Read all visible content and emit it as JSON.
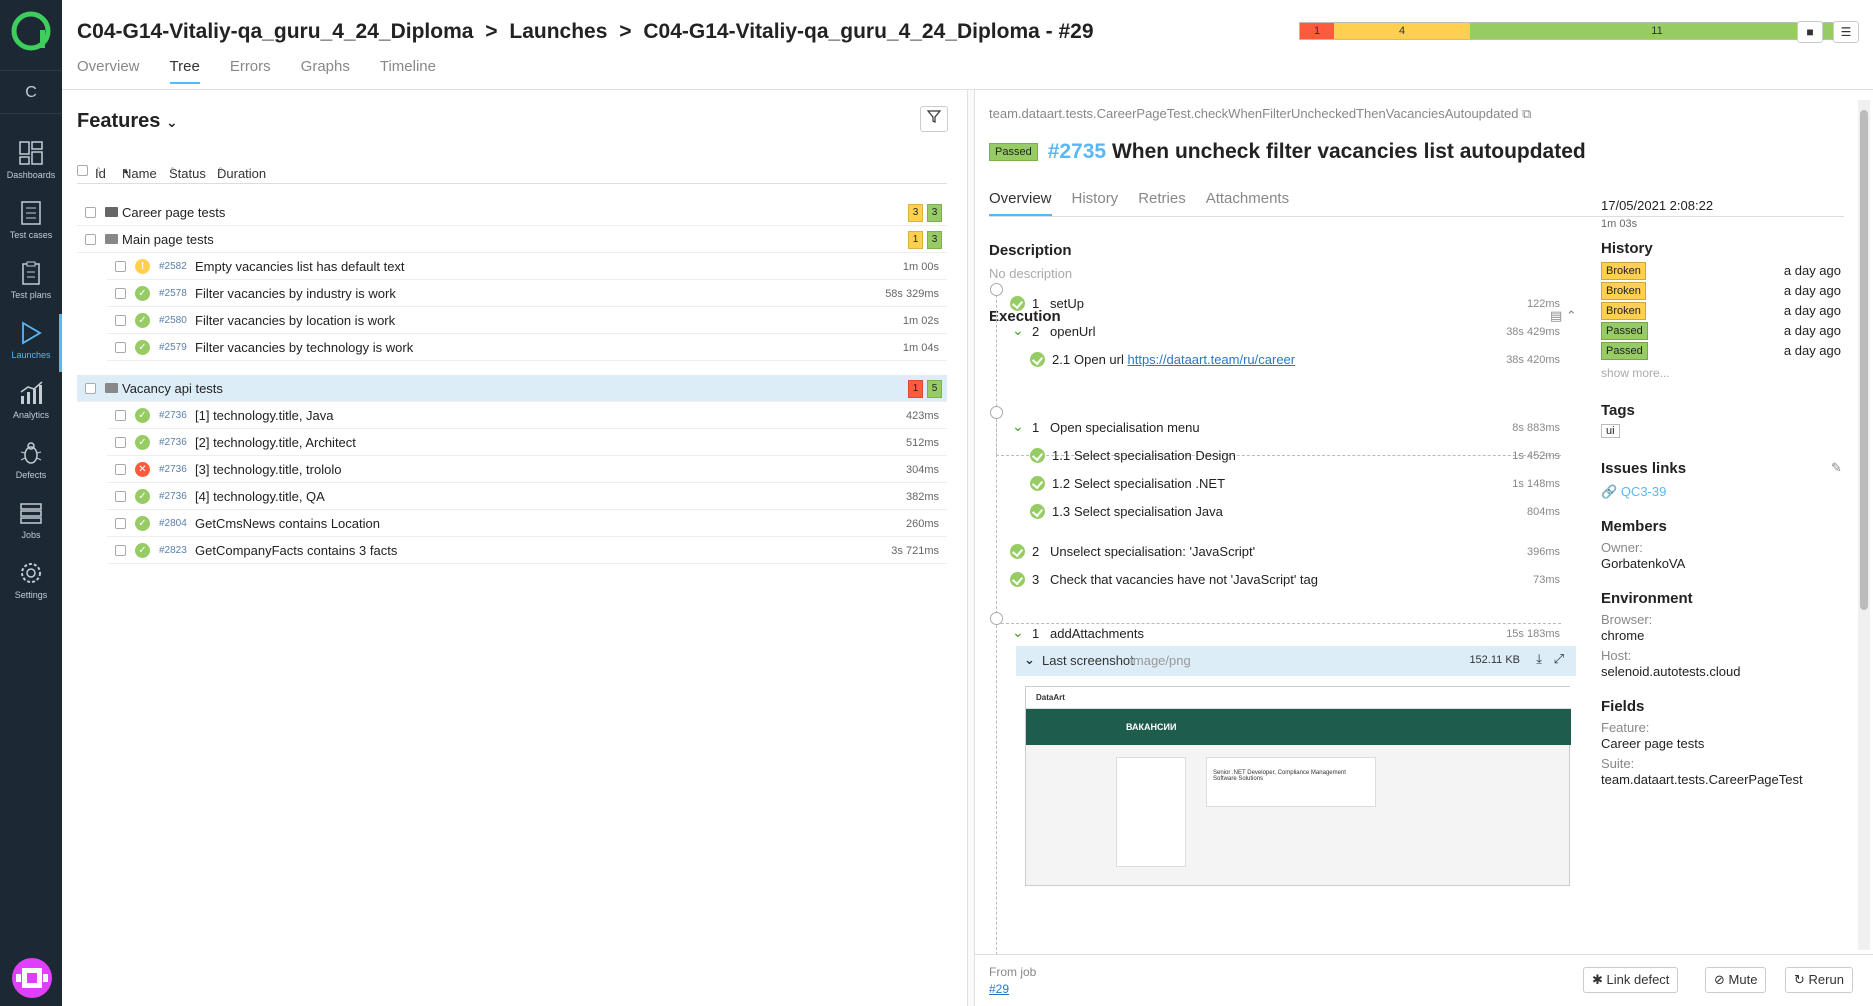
{
  "sidebar": {
    "collapse_label": "C",
    "items": [
      {
        "label": "Dashboards",
        "icon": "dashboards-icon"
      },
      {
        "label": "Test cases",
        "icon": "test-cases-icon"
      },
      {
        "label": "Test plans",
        "icon": "test-plans-icon"
      },
      {
        "label": "Launches",
        "icon": "launches-icon"
      },
      {
        "label": "Analytics",
        "icon": "analytics-icon"
      },
      {
        "label": "Defects",
        "icon": "defects-icon"
      },
      {
        "label": "Jobs",
        "icon": "jobs-icon"
      },
      {
        "label": "Settings",
        "icon": "settings-icon"
      }
    ],
    "accent": "#5ab7f6",
    "background": "#1c2834"
  },
  "header": {
    "crumb1": "C04-G14-Vitaliy-qa_guru_4_24_Diploma",
    "crumb2": "Launches",
    "crumb3": "C04-G14-Vitaliy-qa_guru_4_24_Diploma - #29",
    "separator": ">",
    "tabs": [
      "Overview",
      "Tree",
      "Errors",
      "Graphs",
      "Timeline"
    ],
    "active_tab": "Tree",
    "stats": [
      {
        "label": "1",
        "value": 1,
        "color": "#fd5a3e"
      },
      {
        "label": "4",
        "value": 4,
        "color": "#ffd050"
      },
      {
        "label": "11",
        "value": 11,
        "color": "#97cc64"
      }
    ]
  },
  "left": {
    "title": "Features",
    "columns": {
      "id": "Id",
      "name": "Name",
      "status": "Status",
      "duration": "Duration"
    },
    "groups": [
      {
        "name": "Career page tests",
        "counts": [
          "3",
          "3"
        ]
      },
      {
        "name": "Main page tests",
        "counts": [
          "1",
          "3"
        ]
      },
      {
        "name": "Vacancy api tests",
        "counts": [
          "1",
          "5"
        ]
      }
    ],
    "main_tests": [
      {
        "id": "#2582",
        "name": "Empty vacancies list has default text",
        "duration": "1m 00s",
        "status": "broken"
      },
      {
        "id": "#2578",
        "name": "Filter vacancies by industry is work",
        "duration": "58s 329ms",
        "status": "passed"
      },
      {
        "id": "#2580",
        "name": "Filter vacancies by location is work",
        "duration": "1m 02s",
        "status": "passed"
      },
      {
        "id": "#2579",
        "name": "Filter vacancies by technology is work",
        "duration": "1m 04s",
        "status": "passed"
      }
    ],
    "api_tests": [
      {
        "id": "#2736",
        "name": "[1] technology.title, Java",
        "duration": "423ms",
        "status": "passed"
      },
      {
        "id": "#2736",
        "name": "[2] technology.title, Architect",
        "duration": "512ms",
        "status": "passed"
      },
      {
        "id": "#2736",
        "name": "[3] technology.title, trololo",
        "duration": "304ms",
        "status": "failed"
      },
      {
        "id": "#2736",
        "name": "[4] technology.title, QA",
        "duration": "382ms",
        "status": "passed"
      },
      {
        "id": "#2804",
        "name": "GetCmsNews contains Location",
        "duration": "260ms",
        "status": "passed"
      },
      {
        "id": "#2823",
        "name": "GetCompanyFacts contains 3 facts",
        "duration": "3s 721ms",
        "status": "passed"
      }
    ]
  },
  "detail": {
    "path": "team.dataart.tests.CareerPageTest.checkWhenFilterUncheckedThenVacanciesAutoupdated",
    "badge": "Passed",
    "number": "#2735",
    "title": "When uncheck filter vacancies list autoupdated",
    "tabs": [
      "Overview",
      "History",
      "Retries",
      "Attachments"
    ],
    "description_title": "Description",
    "description": "No description",
    "execution_title": "Execution",
    "setup": [
      {
        "n": "1",
        "name": "setUp",
        "duration": "122ms"
      },
      {
        "n": "2",
        "name": "openUrl",
        "duration": "38s 429ms"
      }
    ],
    "open_url": {
      "n": "2.1",
      "text": "Open url ",
      "link": "https://dataart.team/ru/career",
      "duration": "38s 420ms"
    },
    "body": [
      {
        "n": "1",
        "name": "Open specialisation menu",
        "duration": "8s 883ms"
      },
      {
        "n": "1.1",
        "name": "Select specialisation Design",
        "duration": "1s 452ms"
      },
      {
        "n": "1.2",
        "name": "Select specialisation .NET",
        "duration": "1s 148ms"
      },
      {
        "n": "1.3",
        "name": "Select specialisation Java",
        "duration": "804ms"
      },
      {
        "n": "2",
        "name": "Unselect specialisation: 'JavaScript'",
        "duration": "396ms"
      },
      {
        "n": "3",
        "name": "Check that vacancies have not 'JavaScript' tag",
        "duration": "73ms"
      }
    ],
    "teardown": {
      "n": "1",
      "name": "addAttachments",
      "duration": "15s 183ms"
    },
    "attachment": {
      "name": "Last screenshot",
      "type": "image/png",
      "size": "152.11 KB"
    },
    "screenshot": {
      "logo": "DataArt",
      "banner": "ВАКАНСИИ",
      "vacancy": "Senior .NET Developer, Compliance Management Software Solutions"
    },
    "from_job_label": "From job",
    "from_job": "#29"
  },
  "side": {
    "date": "17/05/2021 2:08:22",
    "duration": "1m 03s",
    "history_title": "History",
    "history": [
      {
        "status": "Broken",
        "when": "a day ago",
        "color": "#ffd050"
      },
      {
        "status": "Broken",
        "when": "a day ago",
        "color": "#ffd050"
      },
      {
        "status": "Broken",
        "when": "a day ago",
        "color": "#ffd050"
      },
      {
        "status": "Passed",
        "when": "a day ago",
        "color": "#97cc64"
      },
      {
        "status": "Passed",
        "when": "a day ago",
        "color": "#97cc64"
      }
    ],
    "show_more": "show more...",
    "tags_title": "Tags",
    "tag": "ui",
    "issues_title": "Issues links",
    "issue": "QC3-39",
    "members_title": "Members",
    "owner_label": "Owner:",
    "owner": "GorbatenkoVA",
    "env_title": "Environment",
    "browser_label": "Browser:",
    "browser": "chrome",
    "host_label": "Host:",
    "host": "selenoid.autotests.cloud",
    "fields_title": "Fields",
    "feature_label": "Feature:",
    "feature": "Career page tests",
    "suite_label": "Suite:",
    "suite": "team.dataart.tests.CareerPageTest"
  },
  "footer": {
    "link_defect": "Link defect",
    "mute": "Mute",
    "rerun": "Rerun"
  }
}
